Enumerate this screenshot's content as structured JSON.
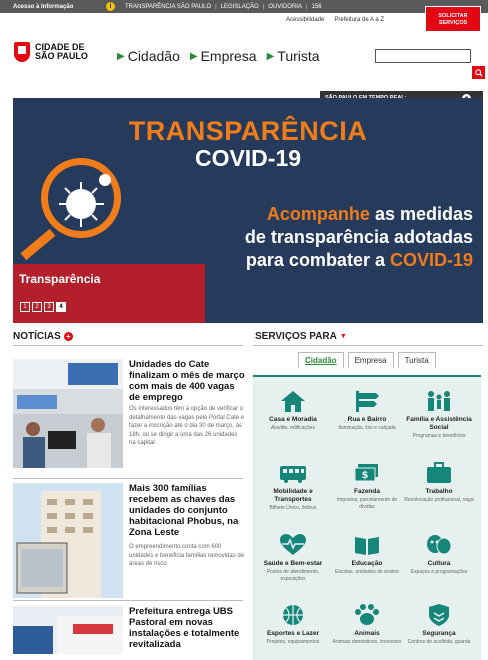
{
  "topbar": {
    "access": "Acesso à Informação",
    "links": [
      "TRANSPARÊNCIA SÃO PAULO",
      "LEGISLAÇÃO",
      "OUVIDORIA",
      "156"
    ]
  },
  "header": {
    "accessibility": "Acessibilidade",
    "a_to_z": "Prefeitura de A a Z",
    "solicitar": "SOLICITAR SERVIÇOS",
    "logo_line1": "CIDADE DE",
    "logo_line2": "SÃO PAULO",
    "nav": [
      "Cidadão",
      "Empresa",
      "Turista"
    ],
    "search_placeholder": "",
    "realtime": "SÃO PAULO EM TEMPO REAL:"
  },
  "banner": {
    "title1": "TRANSPARÊNCIA",
    "title2": "COVID-19",
    "msg_highlight": "Acompanhe",
    "msg_rest1": " as medidas",
    "msg_line2": "de transparência adotadas",
    "msg_line3_pre": "para combater a ",
    "msg_line3_hl": "COVID-19",
    "caption": "Transparência",
    "pages": [
      "1",
      "2",
      "3",
      "4"
    ],
    "active_page": 4
  },
  "news": {
    "title": "NOTÍCIAS",
    "items": [
      {
        "headline": "Unidades do Cate finalizam o mês de março com mais de 400 vagas de emprego",
        "body": "Os interessados têm a opção de verificar o detalhamento das vagas pelo Portal Cate e fazer a inscrição até o dia 30 de março, às 18h, ou se dirigir a uma das 26 unidades na capital"
      },
      {
        "headline": "Mais 300 famílias recebem as chaves das unidades do conjunto habitacional Phobus, na Zona Leste",
        "body": "O empreendimento conta com 600 unidades e beneficia famílias removidas de áreas de risco"
      },
      {
        "headline": "Prefeitura entrega UBS Pastoral em novas instalações e totalmente revitalizada",
        "body": ""
      }
    ]
  },
  "services": {
    "title": "SERVIÇOS PARA",
    "tabs": [
      "Cidadão",
      "Empresa",
      "Turista"
    ],
    "items": [
      {
        "label": "Casa e Moradia",
        "sub": "Aluvião, edificações",
        "icon": "house-icon"
      },
      {
        "label": "Rua e Bairro",
        "sub": "Iluminação, lixo e calçada",
        "icon": "street-icon"
      },
      {
        "label": "Família e Assistência Social",
        "sub": "Programas e benefícios",
        "icon": "family-icon"
      },
      {
        "label": "Mobilidade e Transportes",
        "sub": "Bilhete Único, ônibus",
        "icon": "bus-icon"
      },
      {
        "label": "Fazenda",
        "sub": "Impostos, parcelamento de dívidas",
        "icon": "money-icon"
      },
      {
        "label": "Trabalho",
        "sub": "Recolocação profissional, vaga",
        "icon": "briefcase-icon"
      },
      {
        "label": "Saúde e Bem-estar",
        "sub": "Postos de atendimento, exposições",
        "icon": "health-icon"
      },
      {
        "label": "Educação",
        "sub": "Escolas, unidades de ensino",
        "icon": "book-icon"
      },
      {
        "label": "Cultura",
        "sub": "Espaços e programações",
        "icon": "theater-icon"
      },
      {
        "label": "Esportes e Lazer",
        "sub": "Projetos, equipamentos",
        "icon": "sports-icon"
      },
      {
        "label": "Animais",
        "sub": "Animais domésticos, zoonoses",
        "icon": "paw-icon"
      },
      {
        "label": "Segurança",
        "sub": "Centros de acolhida, guarda",
        "icon": "shield-icon"
      }
    ]
  },
  "colors": {
    "brand_red": "#e30613",
    "teal": "#16857a",
    "orange": "#f07d1a",
    "navy": "#263a5c"
  }
}
